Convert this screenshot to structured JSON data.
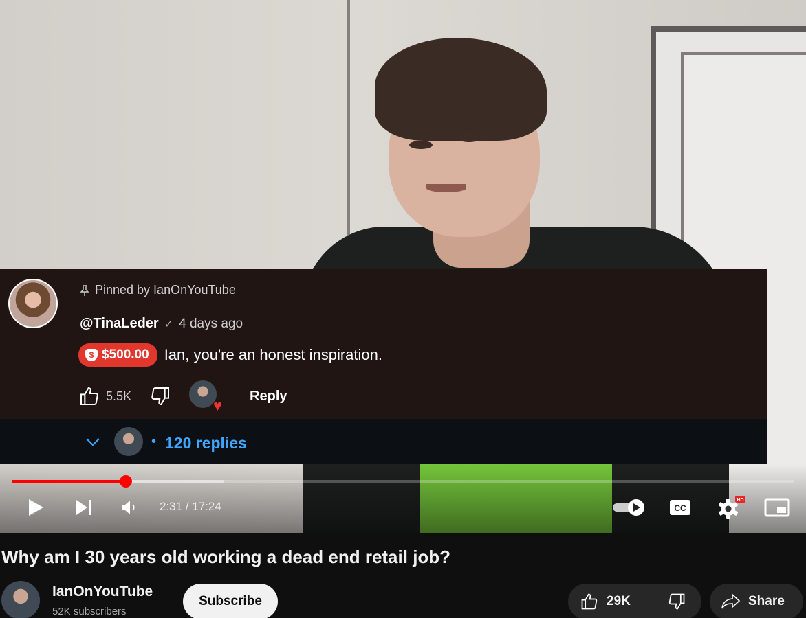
{
  "comment": {
    "pinned_label": "Pinned by IanOnYouTube",
    "author": "@TinaLeder",
    "time": "4 days ago",
    "donation_amount": "$500.00",
    "text": "Ian, you're an honest inspiration.",
    "like_count": "5.5K",
    "reply_label": "Reply",
    "replies_count": "120 replies"
  },
  "player": {
    "current_time": "2:31",
    "duration": "17:24",
    "time_display": "2:31 / 17:24",
    "played_fraction": 0.145,
    "buffered_fraction": 0.27,
    "accent_color": "#ff0000"
  },
  "video": {
    "title": "Why am I 30 years old working a dead end retail job?",
    "channel_name": "IanOnYouTube",
    "subscribers": "52K subscribers",
    "subscribe_label": "Subscribe",
    "likes": "29K",
    "share_label": "Share"
  },
  "colors": {
    "comment_bg": "#211514",
    "donation": "#e2372c",
    "link_blue": "#3ea6ff"
  }
}
